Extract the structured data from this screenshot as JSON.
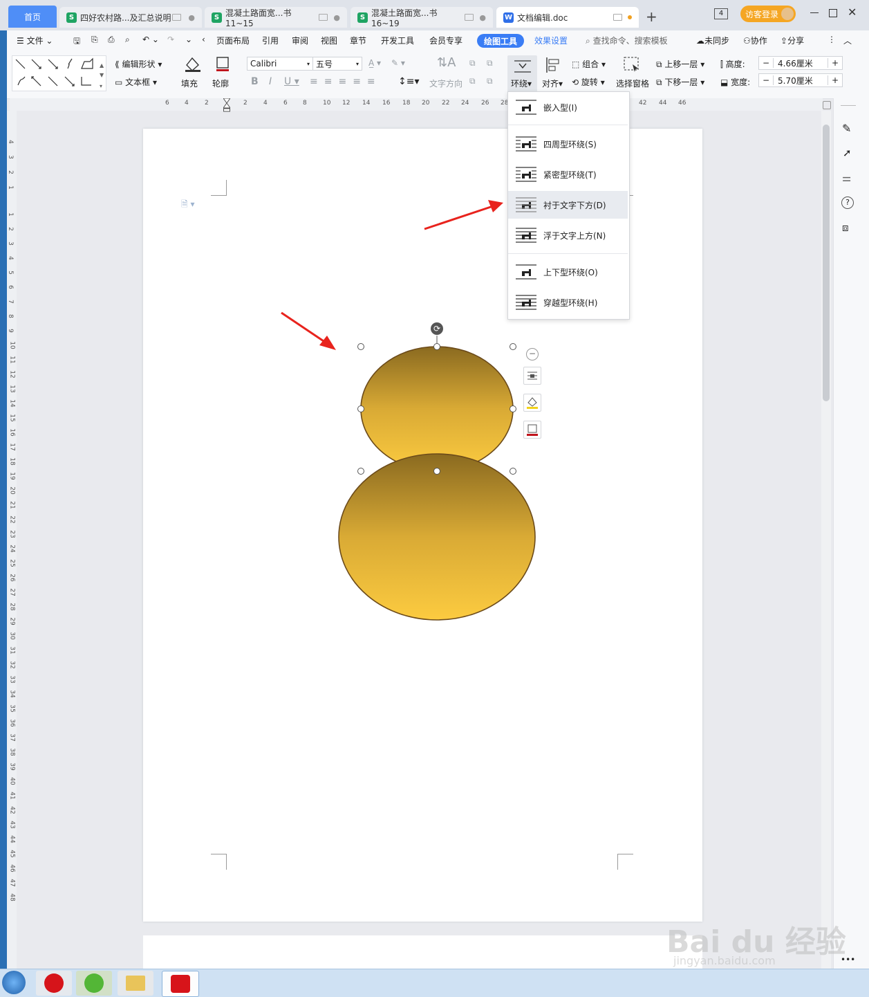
{
  "tabs": [
    {
      "label": "首页",
      "kind": "home"
    },
    {
      "label": "四好农村路...及汇总说明",
      "kind": "sheet"
    },
    {
      "label": "混凝土路面宽...书11~15",
      "kind": "sheet"
    },
    {
      "label": "混凝土路面宽...书16~19",
      "kind": "sheet"
    },
    {
      "label": "文档编辑.doc",
      "kind": "doc"
    }
  ],
  "titlebar": {
    "new_tab": "+",
    "window_count": "4",
    "login": "访客登录"
  },
  "menu": {
    "file": "文件",
    "items": [
      "页面布局",
      "引用",
      "审阅",
      "视图",
      "章节",
      "开发工具",
      "会员专享"
    ],
    "drawing_tools": "绘图工具",
    "effects": "效果设置",
    "search": "查找命令、搜索模板",
    "sync": "未同步",
    "collab": "协作",
    "share": "分享"
  },
  "ribbon": {
    "edit_shape": "编辑形状",
    "text_box": "文本框",
    "fill": "填充",
    "outline": "轮廓",
    "font": "Calibri",
    "size": "五号",
    "text_direction": "文字方向",
    "wrap": "环绕",
    "align": "对齐",
    "group": "组合",
    "rotate": "旋转",
    "selection_pane": "选择窗格",
    "bring_forward": "上移一层",
    "send_backward": "下移一层",
    "height_label": "高度:",
    "height_value": "4.66厘米",
    "width_label": "宽度:",
    "width_value": "5.70厘米"
  },
  "ruler": {
    "h_ticks": [
      "6",
      "4",
      "2",
      "2",
      "4",
      "6",
      "8",
      "10",
      "12",
      "14",
      "16",
      "18",
      "20",
      "22",
      "24",
      "26",
      "28",
      "42",
      "44",
      "46"
    ],
    "v_ticks": [
      "4",
      "3",
      "2",
      "1",
      "1",
      "2",
      "3",
      "4",
      "5",
      "6",
      "7",
      "8",
      "9",
      "10",
      "11",
      "12",
      "13",
      "14",
      "15",
      "16",
      "17",
      "18",
      "19",
      "20",
      "21",
      "22",
      "23",
      "24",
      "25",
      "26",
      "27",
      "28",
      "29",
      "30",
      "31",
      "32",
      "33",
      "34",
      "35",
      "36",
      "37",
      "38",
      "39",
      "40",
      "41",
      "42",
      "43",
      "44",
      "45",
      "46",
      "47",
      "48"
    ]
  },
  "wrap_menu": {
    "items": [
      {
        "label": "嵌入型(I)",
        "icon": "inline-wrap-icon"
      },
      {
        "label": "四周型环绕(S)",
        "icon": "square-wrap-icon"
      },
      {
        "label": "紧密型环绕(T)",
        "icon": "tight-wrap-icon"
      },
      {
        "label": "衬于文字下方(D)",
        "icon": "behind-text-icon"
      },
      {
        "label": "浮于文字上方(N)",
        "icon": "in-front-text-icon"
      },
      {
        "label": "上下型环绕(O)",
        "icon": "top-bottom-wrap-icon"
      },
      {
        "label": "穿越型环绕(H)",
        "icon": "through-wrap-icon"
      }
    ],
    "highlighted_index": 3
  },
  "shapes": {
    "fill_top": "#8a6a20",
    "fill_bottom": "#fccb40",
    "stroke": "#6b4a1a"
  },
  "watermark": {
    "brand": "Bai du 经验",
    "url": "jingyan.baidu.com"
  },
  "colors": {
    "accent": "#3a7df5",
    "arrow": "#e8231d",
    "login_bg": "#f5a623"
  }
}
